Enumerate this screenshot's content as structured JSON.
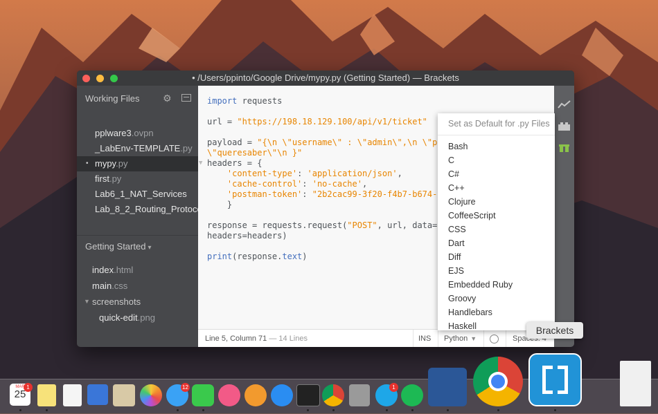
{
  "window": {
    "title": "• /Users/ppinto/Google Drive/mypy.py (Getting Started) — Brackets"
  },
  "sidebar": {
    "working_files_label": "Working Files",
    "working_files": [
      {
        "name": "pplware3",
        "ext": ".ovpn",
        "active": false
      },
      {
        "name": "_LabEnv-TEMPLATE",
        "ext": ".py",
        "active": false
      },
      {
        "name": "mypy",
        "ext": ".py",
        "active": true,
        "dirty": "•"
      },
      {
        "name": "first",
        "ext": ".py",
        "active": false
      },
      {
        "name": "Lab6_1_NAT_Services",
        "ext": "",
        "active": false
      },
      {
        "name": "Lab_8_2_Routing_Protoco",
        "ext": "",
        "active": false
      }
    ],
    "project_label": "Getting Started",
    "tree": [
      {
        "name": "index",
        "ext": ".html"
      },
      {
        "name": "main",
        "ext": ".css"
      },
      {
        "name": "screenshots",
        "ext": ""
      },
      {
        "name": "quick-edit",
        "ext": ".png"
      }
    ]
  },
  "code": {
    "l1_kw": "import",
    "l1_rest": " requests",
    "l3_a": "url = ",
    "l3_str": "\"https://198.18.129.100/api/v1/ticket\"",
    "l5_a": "payload = ",
    "l5_str": "\"{\\n \\\"username\\\" : \\\"admin\\\",\\n \\\"pa",
    "l6_str": "\\\"queresaber\\\"\\n }\"",
    "l7": "headers = {",
    "l8_key": "'content-type'",
    "l8_val": "'application/json'",
    "l9_key": "'cache-control'",
    "l9_val": "'no-cache'",
    "l10_key": "'postman-token'",
    "l10_val": "\"2b2cac99-3f20-f4b7-b674-5",
    "l11": "}",
    "l13_a": "response = requests.request(",
    "l13_str": "\"POST\"",
    "l13_b": ", url, data=p",
    "l14": "headers=headers)",
    "l16_kw": "print",
    "l16_a": "(response.",
    "l16_kw2": "text",
    "l16_b": ")"
  },
  "statusbar": {
    "position": "Line 5, Column 71",
    "lines": "— 14 Lines",
    "ins": "INS",
    "language": "Python",
    "spaces": "Spaces: 4"
  },
  "language_menu": {
    "default_label": "Set as Default for .py Files",
    "options": [
      "Bash",
      "C",
      "C#",
      "C++",
      "Clojure",
      "CoffeeScript",
      "CSS",
      "Dart",
      "Diff",
      "EJS",
      "Embedded Ruby",
      "Groovy",
      "Handlebars",
      "Haskell"
    ]
  },
  "tooltip": "Brackets",
  "dock": {
    "calendar_month": "MAR",
    "calendar_day": "25",
    "badges": {
      "calendar": "1",
      "messages": "12",
      "skype": "1"
    }
  },
  "colors": {
    "accent_string": "#e88501",
    "accent_keyword": "#446fbd",
    "brackets_blue": "#2193d7"
  }
}
